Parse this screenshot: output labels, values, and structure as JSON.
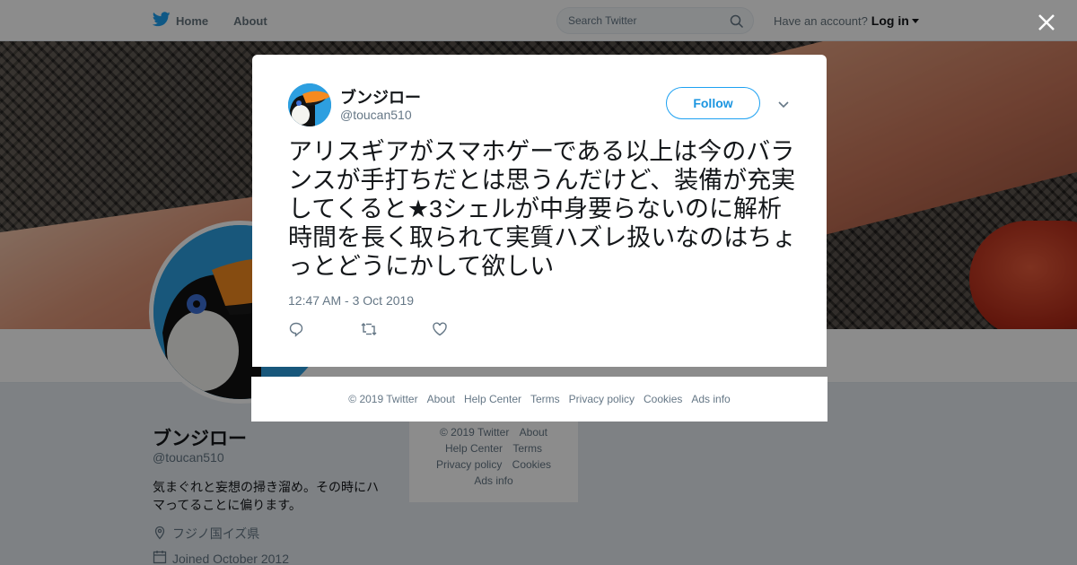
{
  "nav": {
    "home_label": "Home",
    "about_label": "About",
    "search_placeholder": "Search Twitter",
    "account_prompt": "Have an account?",
    "login_label": "Log in"
  },
  "profile": {
    "name": "ブンジロー",
    "handle": "@toucan510",
    "bio": "気まぐれと妄想の掃き溜め。その時にハマってることに偏ります。",
    "location": "フジノ国イズ県",
    "joined": "Joined October 2012"
  },
  "side_footer": {
    "row1": [
      "© 2019 Twitter",
      "About"
    ],
    "row2": [
      "Help Center",
      "Terms"
    ],
    "row3": [
      "Privacy policy",
      "Cookies"
    ],
    "row4": [
      "Ads info"
    ]
  },
  "tweet": {
    "name": "ブンジロー",
    "handle": "@toucan510",
    "follow_label": "Follow",
    "text": "アリスギアがスマホゲーである以上は今のバランスが手打ちだとは思うんだけど、装備が充実してくると★3シェルが中身要らないのに解析時間を長く取られて実質ハズレ扱いなのはちょっとどうにかして欲しい",
    "timestamp": "12:47 AM - 3 Oct 2019"
  },
  "modal_footer": {
    "links": [
      "© 2019 Twitter",
      "About",
      "Help Center",
      "Terms",
      "Privacy policy",
      "Cookies",
      "Ads info"
    ]
  },
  "colors": {
    "brand_blue": "#1da1f2",
    "text_dark": "#14171a",
    "text_gray": "#657786",
    "overlay": "rgba(0,0,0,0.45)"
  },
  "icons": [
    "twitter-bird-icon",
    "search-icon",
    "close-icon",
    "chevron-down-icon",
    "reply-icon",
    "retweet-icon",
    "like-icon",
    "location-icon",
    "calendar-icon"
  ]
}
